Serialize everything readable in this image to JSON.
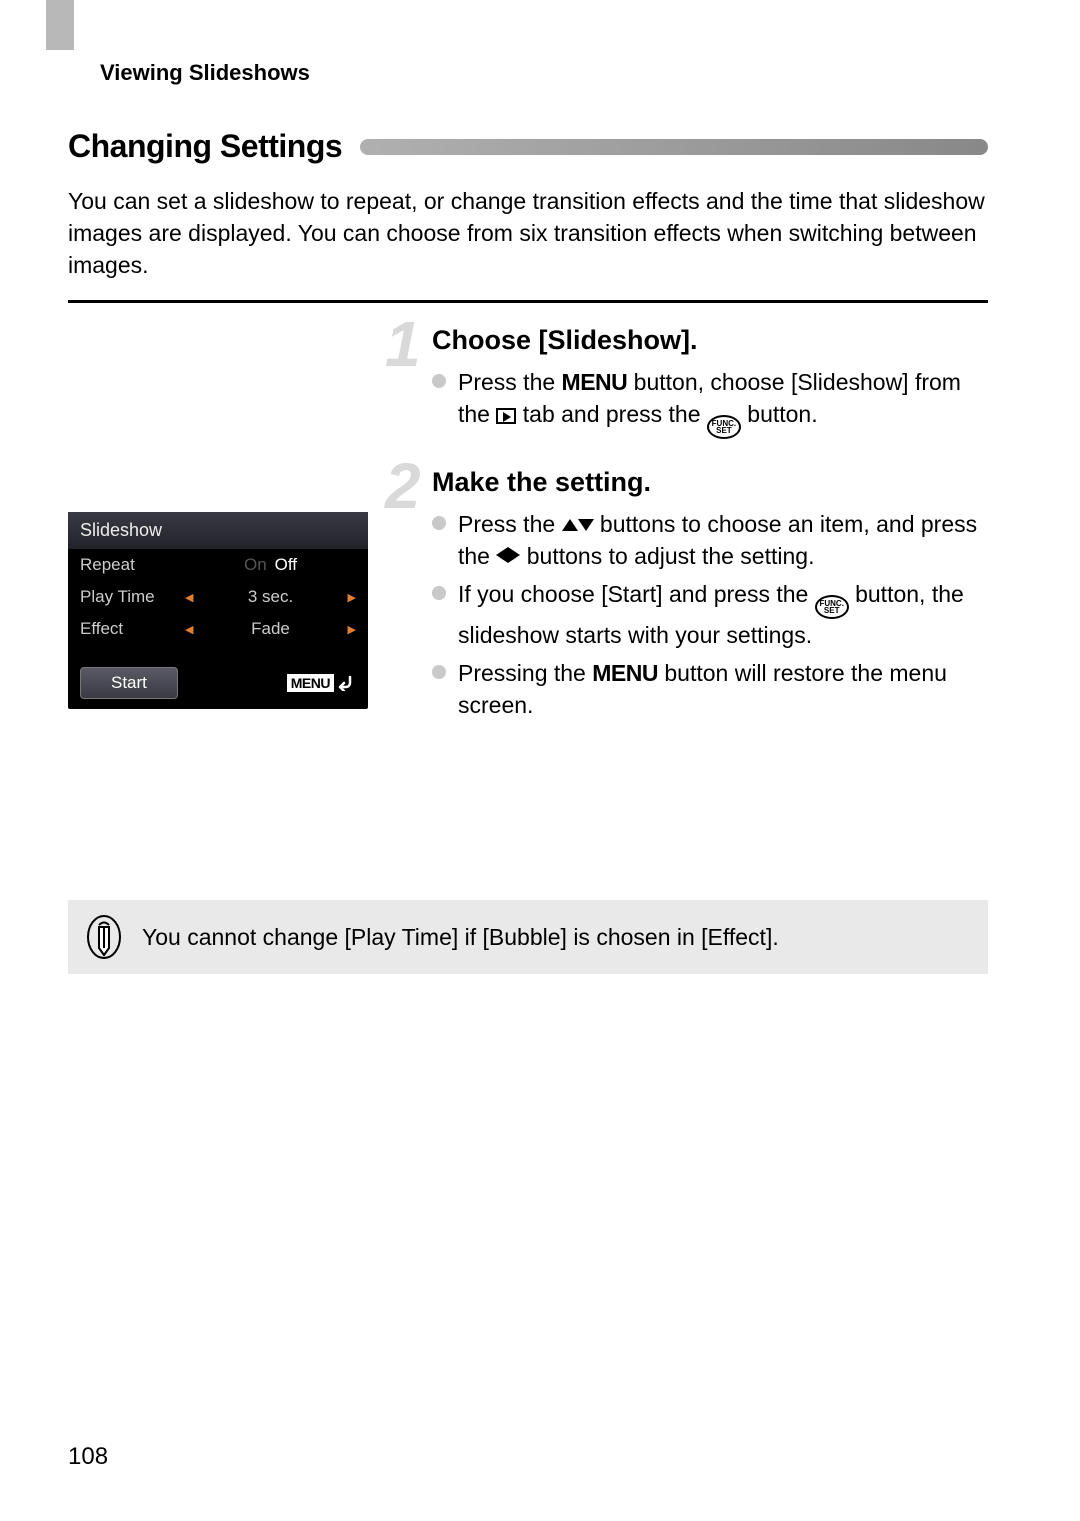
{
  "breadcrumb": "Viewing Slideshows",
  "section_heading": "Changing Settings",
  "intro": "You can set a slideshow to repeat, or change transition effects and the time that slideshow images are displayed. You can choose from six transition effects when switching between images.",
  "camera": {
    "title": "Slideshow",
    "rows": {
      "repeat": {
        "label": "Repeat",
        "on": "On",
        "off": "Off"
      },
      "playtime": {
        "label": "Play Time",
        "value": "3 sec."
      },
      "effect": {
        "label": "Effect",
        "value": "Fade"
      }
    },
    "start": "Start",
    "menu": "MENU"
  },
  "steps": [
    {
      "num": "1",
      "title": "Choose [Slideshow].",
      "bullets": [
        {
          "parts": [
            "Press the ",
            {
              "t": "menu",
              "v": "MENU"
            },
            " button, choose [Slideshow] from the ",
            {
              "t": "play"
            },
            " tab and press the ",
            {
              "t": "func"
            },
            " button."
          ]
        }
      ]
    },
    {
      "num": "2",
      "title": "Make the setting.",
      "bullets": [
        {
          "parts": [
            "Press the ",
            {
              "t": "updown"
            },
            " buttons to choose an item, and press the ",
            {
              "t": "leftright"
            },
            " buttons to adjust the setting."
          ]
        },
        {
          "parts": [
            "If you choose [Start] and press the ",
            {
              "t": "func"
            },
            " button, the slideshow starts with your settings."
          ]
        },
        {
          "parts": [
            "Pressing the ",
            {
              "t": "menu",
              "v": "MENU"
            },
            " button will restore the menu screen."
          ]
        }
      ]
    }
  ],
  "note": "You cannot change [Play Time] if [Bubble] is chosen in [Effect].",
  "page_number": "108"
}
